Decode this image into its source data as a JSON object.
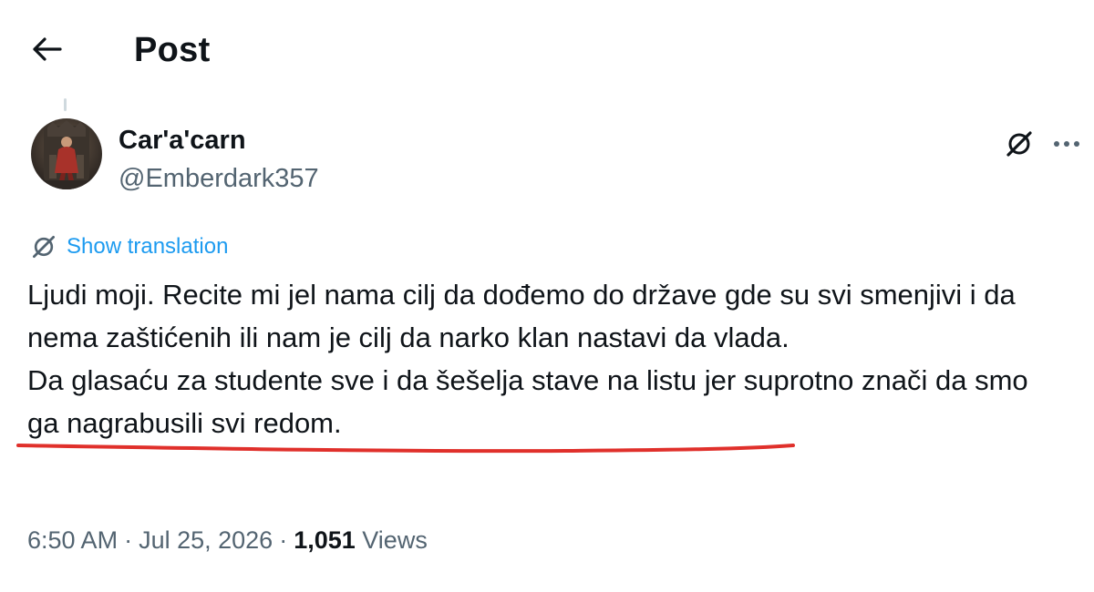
{
  "header": {
    "title": "Post",
    "back_icon": "arrow-left-icon"
  },
  "author": {
    "display_name": "Car'a'carn",
    "handle": "@Emberdark357",
    "avatar_icon": "avatar-image"
  },
  "actions": {
    "grok_icon": "grok-icon",
    "more_icon": "more-horizontal-icon"
  },
  "translation": {
    "icon": "grok-icon",
    "label": "Show translation"
  },
  "post": {
    "paragraph_1": "Ljudi moji. Recite mi jel nama cilj da dođemo do države gde su svi smenjivi i da nema zaštićenih ili nam je cilj da narko klan nastavi da vlada.",
    "paragraph_2_underlined": "Da glasaću za studente sve i da šešelja stave na listu",
    "paragraph_2_rest": " jer suprotno znači da smo ga nagrabusili svi redom.",
    "highlight_color": "#e0302b"
  },
  "meta": {
    "time": "6:50 AM",
    "separator": "·",
    "date": "Jul 25, 2026",
    "views_count": "1,051",
    "views_label": "Views"
  },
  "colors": {
    "text": "#0f1419",
    "secondary": "#536471",
    "accent": "#1d9bf0"
  }
}
